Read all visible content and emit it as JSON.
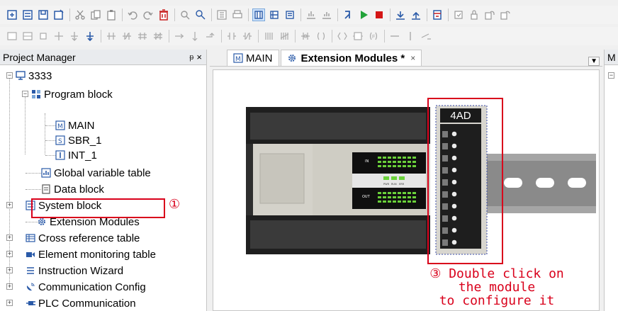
{
  "toolbar_primary": {
    "icons": [
      "new-project-icon",
      "open-icon",
      "save-icon",
      "save-as-icon",
      "cut-icon",
      "copy-icon",
      "paste-icon",
      "undo-icon",
      "redo-icon",
      "delete-icon",
      "find-icon",
      "replace-icon",
      "compile-icon",
      "print-icon",
      "view-ladder-icon",
      "view-stl-icon",
      "view-fbd-icon",
      "upload-icon",
      "download-icon",
      "run-icon",
      "play-icon",
      "stop-icon",
      "monitor-icon",
      "monitor-stop-icon",
      "toggle-icon",
      "lock-icon",
      "unlock-icon",
      "password-icon",
      "password-clear-icon"
    ]
  },
  "toolbar_secondary": {
    "icons": [
      "insert-network-icon",
      "insert-row-icon",
      "add-line-icon",
      "insert-down-icon",
      "delete-down-icon",
      "contact-no-icon",
      "contact-nc-icon",
      "contact-p-icon",
      "contact-n-icon",
      "right-arrow-icon",
      "down-arrow-icon",
      "connect-icon",
      "ladder-contact-icon",
      "ladder-nc-icon",
      "parallel-icon",
      "parallel-nc-icon",
      "fb-icon",
      "coil-icon",
      "box-icon",
      "func-icon",
      "hline-icon",
      "vline-icon",
      "del-line-icon",
      "up-arrow-icon",
      "down-small-arrow-icon"
    ]
  },
  "project_manager": {
    "title": "Project Manager",
    "pin": "ᵽ",
    "close": "×",
    "tree": {
      "root": "3333",
      "program_block": "Program block",
      "main": "MAIN",
      "sbr": "SBR_1",
      "int": "INT_1",
      "global_var": "Global variable table",
      "data_block": "Data block",
      "system_block": "System block",
      "extension_modules": "Extension Modules",
      "cross_ref": "Cross reference table",
      "element_monitor": "Element monitoring table",
      "instruction_wizard": "Instruction Wizard",
      "comm_config": "Communication Config",
      "plc_comm": "PLC Communication"
    }
  },
  "editor": {
    "tabs": [
      {
        "label": "MAIN"
      },
      {
        "label": "Extension Modules *",
        "close": "×"
      }
    ],
    "module_label": "4AD",
    "plc_labels": {
      "in": "IN",
      "out": "OUT",
      "pwr": "PWR",
      "run": "RUN",
      "err": "ERR"
    }
  },
  "right_panel": {
    "title": "M"
  },
  "annotations": {
    "step1": "①",
    "step3_line1": "③ Double click on",
    "step3_line2": "the module",
    "step3_line3": "to configure it"
  },
  "colors": {
    "annotation": "#d9001b",
    "rail": "#777777",
    "module_dark": "#2b2b2b",
    "led_green": "#6ad13a"
  }
}
